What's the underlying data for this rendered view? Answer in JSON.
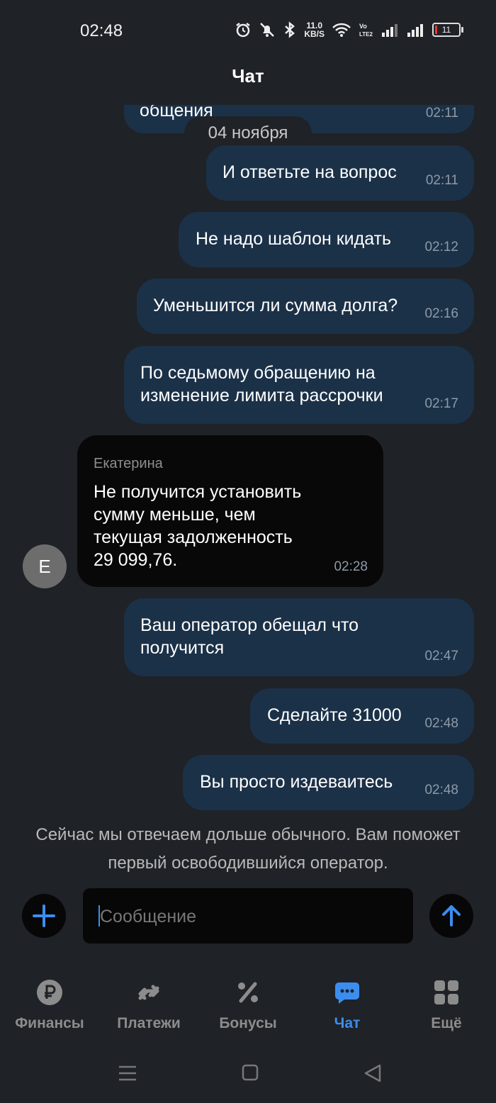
{
  "status_bar": {
    "time": "02:48",
    "net_speed_value": "11.0",
    "net_speed_unit": "KB/S",
    "battery": "11",
    "icons": [
      "alarm-icon",
      "mute-icon",
      "bluetooth-icon",
      "wifi-icon",
      "volte-icon",
      "signal-icon",
      "signal-icon",
      "battery-icon"
    ]
  },
  "header": {
    "title": "Чат"
  },
  "chat": {
    "date_divider": "04 ноября",
    "messages": [
      {
        "direction": "out",
        "text": "общения",
        "time": "02:11"
      },
      {
        "direction": "out",
        "text": "И ответьте на вопрос",
        "time": "02:11"
      },
      {
        "direction": "out",
        "text": "Не надо шаблон кидать",
        "time": "02:12"
      },
      {
        "direction": "out",
        "text": "Уменьшится ли сумма долга?",
        "time": "02:16"
      },
      {
        "direction": "out",
        "text_lines": [
          "По седьмому обращению на",
          "изменение лимита рассрочки"
        ],
        "time": "02:17"
      },
      {
        "direction": "in",
        "sender": "Екатерина",
        "avatar_letter": "Е",
        "text_lines": [
          "Не получится установить",
          "сумму меньше, чем",
          "текущая задолженность",
          "29 099,76."
        ],
        "time": "02:28"
      },
      {
        "direction": "out",
        "text_lines": [
          "Ваш оператор обещал что",
          "получится"
        ],
        "time": "02:47"
      },
      {
        "direction": "out",
        "text": "Сделайте 31000",
        "time": "02:48"
      },
      {
        "direction": "out",
        "text": "Вы просто издеваитесь",
        "time": "02:48"
      }
    ]
  },
  "notice": "Сейчас мы отвечаем дольше обычного. Вам поможет первый освободившийся оператор.",
  "composer": {
    "placeholder": "Сообщение"
  },
  "tabbar": {
    "tabs": [
      {
        "label": "Финансы",
        "icon": "ruble-icon",
        "active": false
      },
      {
        "label": "Платежи",
        "icon": "transfer-icon",
        "active": false
      },
      {
        "label": "Бонусы",
        "icon": "percent-icon",
        "active": false
      },
      {
        "label": "Чат",
        "icon": "chat-icon",
        "active": true
      },
      {
        "label": "Ещё",
        "icon": "grid-icon",
        "active": false
      }
    ]
  },
  "colors": {
    "accent": "#3b8ef0",
    "out_bubble": "#1b3148",
    "in_bubble": "#080808",
    "background": "#1f2227"
  }
}
